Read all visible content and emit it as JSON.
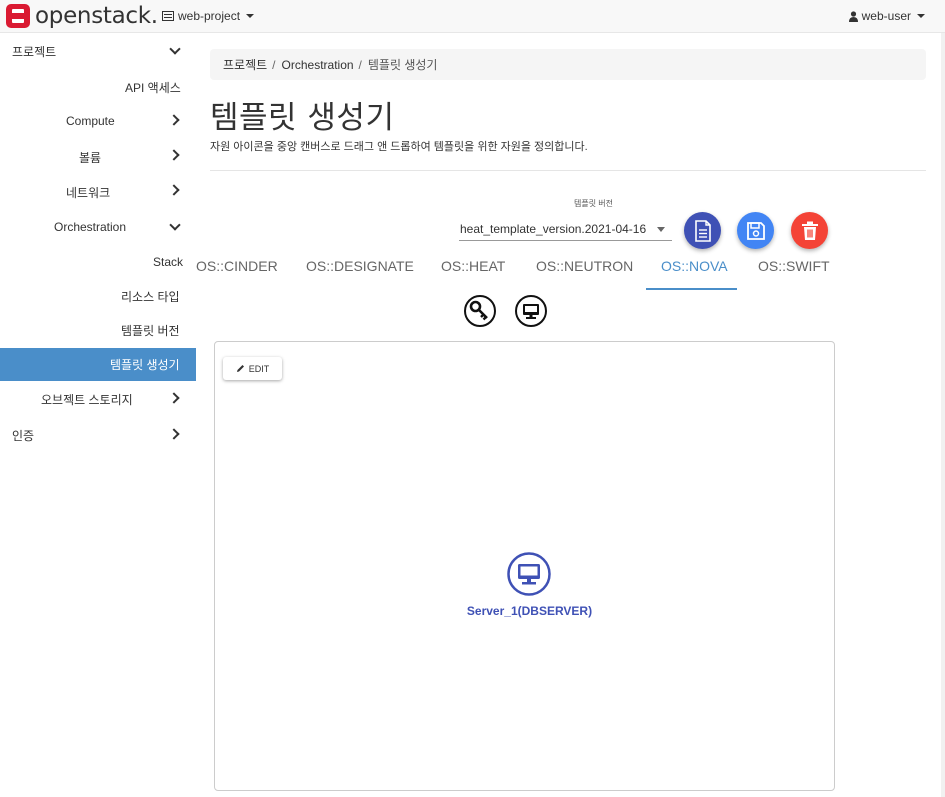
{
  "header": {
    "brand": "openstack.",
    "project": "web-project",
    "user": "web-user"
  },
  "sidebar": {
    "items": [
      {
        "label": "프로젝트",
        "state": "expanded"
      },
      {
        "label": "API 액세스"
      },
      {
        "label": "Compute",
        "state": "collapsed"
      },
      {
        "label": "볼륨",
        "state": "collapsed"
      },
      {
        "label": "네트워크",
        "state": "collapsed"
      },
      {
        "label": "Orchestration",
        "state": "expanded"
      },
      {
        "label": "Stack"
      },
      {
        "label": "리소스 타입"
      },
      {
        "label": "템플릿 버전"
      },
      {
        "label": "템플릿 생성기",
        "active": true
      },
      {
        "label": "오브젝트 스토리지",
        "state": "collapsed"
      },
      {
        "label": "인증",
        "state": "collapsed"
      }
    ]
  },
  "breadcrumb": [
    "프로젝트",
    "Orchestration",
    "템플릿 생성기"
  ],
  "page": {
    "title": "템플릿 생성기",
    "description": "자원 아이콘을 중앙 캔버스로 드래그 앤 드롭하여 템플릿을 위한 자원을 정의합니다."
  },
  "template_version": {
    "label": "템플릿 버전",
    "value": "heat_template_version.2021-04-16"
  },
  "actions": [
    {
      "name": "document-icon",
      "color": "#3f51b5"
    },
    {
      "name": "save-icon",
      "color": "#4285f4"
    },
    {
      "name": "trash-icon",
      "color": "#f44336"
    }
  ],
  "tabs": [
    {
      "label": "OS::CINDER"
    },
    {
      "label": "OS::DESIGNATE"
    },
    {
      "label": "OS::HEAT"
    },
    {
      "label": "OS::NEUTRON"
    },
    {
      "label": "OS::NOVA",
      "active": true
    },
    {
      "label": "OS::SWIFT"
    }
  ],
  "resource_icons": [
    "key-icon",
    "monitor-icon"
  ],
  "canvas": {
    "edit_label": "EDIT",
    "nodes": [
      {
        "label": "Server_1(DBSERVER)",
        "icon": "monitor-icon"
      }
    ]
  },
  "colors": {
    "active": "#4a8ec9",
    "node": "#3f51b5"
  }
}
